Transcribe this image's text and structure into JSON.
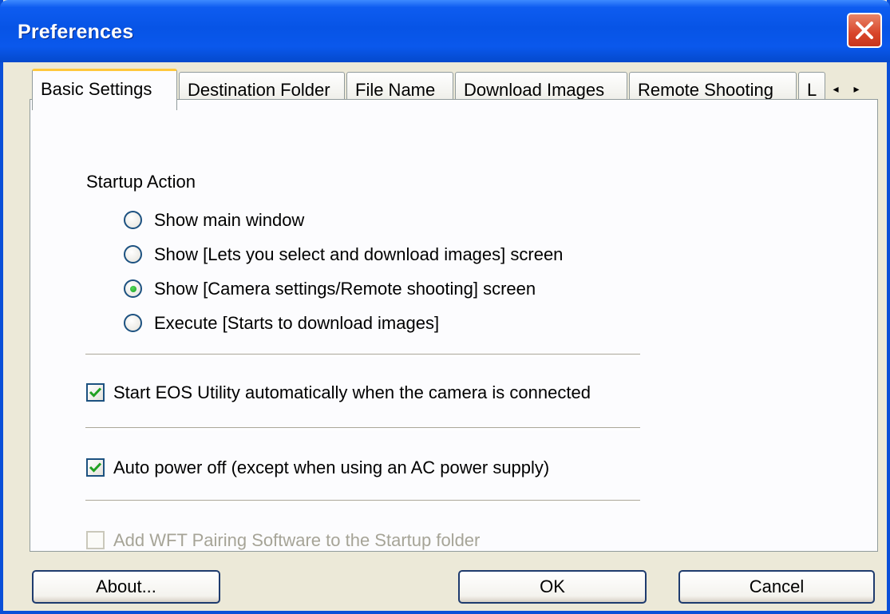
{
  "window": {
    "title": "Preferences"
  },
  "tabs": [
    {
      "label": "Basic Settings",
      "active": true
    },
    {
      "label": "Destination Folder",
      "active": false
    },
    {
      "label": "File Name",
      "active": false
    },
    {
      "label": "Download Images",
      "active": false
    },
    {
      "label": "Remote Shooting",
      "active": false
    },
    {
      "label": "L",
      "active": false
    }
  ],
  "tab_scroll": {
    "left": "◂",
    "right": "▸"
  },
  "startup": {
    "heading": "Startup Action",
    "options": [
      {
        "label": "Show main window",
        "selected": false
      },
      {
        "label": "Show [Lets you select and download images] screen",
        "selected": false
      },
      {
        "label": "Show [Camera settings/Remote shooting] screen",
        "selected": true
      },
      {
        "label": "Execute [Starts to download images]",
        "selected": false
      }
    ]
  },
  "options": {
    "auto_start": {
      "label": "Start EOS Utility automatically when the camera is connected",
      "checked": true
    },
    "auto_power_off": {
      "label": "Auto power off (except when using an AC power supply)",
      "checked": true
    },
    "wft_pairing": {
      "label": "Add WFT Pairing Software to the Startup folder",
      "checked": false,
      "enabled": false
    }
  },
  "buttons": {
    "about": "About...",
    "ok": "OK",
    "cancel": "Cancel"
  },
  "colors": {
    "titlebar": "#0754E6",
    "close": "#D8452A",
    "active_tab_accent": "#FFC83C",
    "face": "#ECE9D8"
  }
}
